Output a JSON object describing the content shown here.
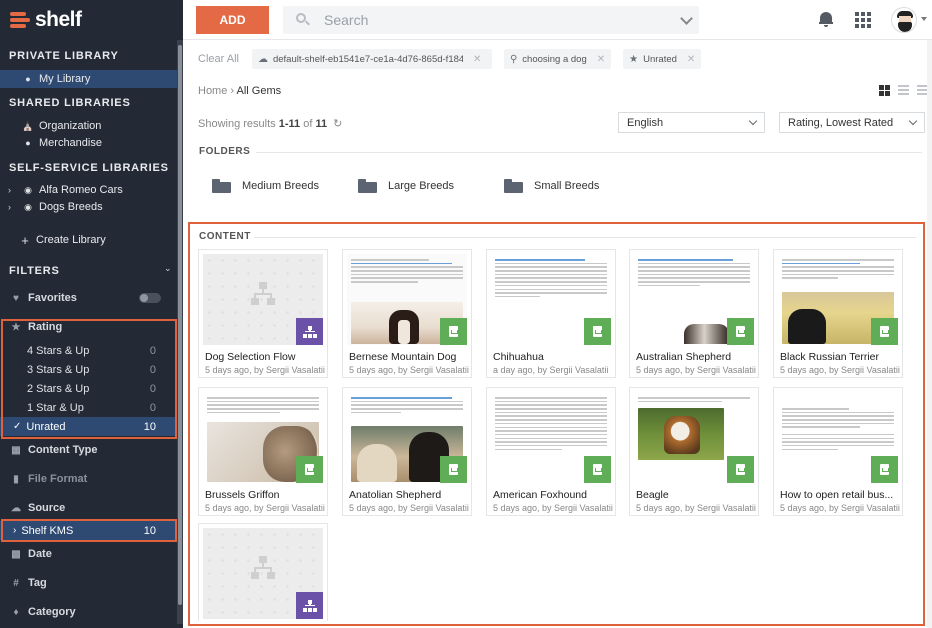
{
  "app": {
    "logo_text": "shelf"
  },
  "sidebar": {
    "private_library_heading": "PRIVATE LIBRARY",
    "my_library": "My Library",
    "shared_libraries_heading": "SHARED LIBRARIES",
    "shared": [
      "Organization",
      "Merchandise"
    ],
    "self_service_heading": "SELF-SERVICE LIBRARIES",
    "self_service": [
      "Alfa Romeo Cars",
      "Dogs Breeds"
    ],
    "create_library": "Create Library",
    "filters_heading": "FILTERS",
    "favorites": "Favorites",
    "rating": "Rating",
    "rating_options": [
      {
        "label": "4 Stars & Up",
        "count": "0"
      },
      {
        "label": "3 Stars & Up",
        "count": "0"
      },
      {
        "label": "2 Stars & Up",
        "count": "0"
      },
      {
        "label": "1 Star & Up",
        "count": "0"
      },
      {
        "label": "Unrated",
        "count": "10"
      }
    ],
    "content_type": "Content Type",
    "file_format": "File Format",
    "source": "Source",
    "source_item": {
      "label": "Shelf KMS",
      "count": "10"
    },
    "date": "Date",
    "tag": "Tag",
    "category": "Category"
  },
  "topbar": {
    "add_label": "ADD",
    "search_placeholder": "Search"
  },
  "chips": {
    "clear_all": "Clear All",
    "items": [
      "default-shelf-eb1541e7-ce1a-4d76-865d-f184468b35...",
      "choosing a dog",
      "Unrated"
    ]
  },
  "breadcrumb": {
    "home": "Home",
    "separator": "›",
    "current": "All Gems"
  },
  "results": {
    "prefix": "Showing results ",
    "range": "1-11",
    "of": " of ",
    "total": "11"
  },
  "language_select": "English",
  "sort_select": "Rating, Lowest Rated",
  "folders": {
    "heading": "FOLDERS",
    "items": [
      "Medium Breeds",
      "Large Breeds",
      "Small Breeds"
    ]
  },
  "content": {
    "heading": "CONTENT",
    "cards": [
      {
        "title": "Dog Selection Flow",
        "meta": "5 days ago, by Sergii Vasalatii",
        "kind": "flow"
      },
      {
        "title": "Bernese Mountain Dog",
        "meta": "5 days ago, by Sergii Vasalatii",
        "kind": "doc"
      },
      {
        "title": "Chihuahua",
        "meta": "a day ago, by Sergii Vasalatii",
        "kind": "doc"
      },
      {
        "title": "Australian Shepherd",
        "meta": "5 days ago, by Sergii Vasalatii",
        "kind": "doc"
      },
      {
        "title": "Black Russian Terrier",
        "meta": "5 days ago, by Sergii Vasalatii",
        "kind": "doc"
      },
      {
        "title": "Brussels Griffon",
        "meta": "5 days ago, by Sergii Vasalatii",
        "kind": "doc"
      },
      {
        "title": "Anatolian Shepherd",
        "meta": "5 days ago, by Sergii Vasalatii",
        "kind": "doc"
      },
      {
        "title": "American Foxhound",
        "meta": "5 days ago, by Sergii Vasalatii",
        "kind": "doc"
      },
      {
        "title": "Beagle",
        "meta": "5 days ago, by Sergii Vasalatii",
        "kind": "doc"
      },
      {
        "title": "How to open retail bus...",
        "meta": "5 days ago, by Sergii Vasalatii",
        "kind": "doc"
      },
      {
        "title": "",
        "meta": "",
        "kind": "flow"
      }
    ]
  },
  "colors": {
    "accent": "#e36a44",
    "sidebar_bg": "#232a35",
    "selected": "#2f4a72",
    "badge_purple": "#6b52a8",
    "badge_green": "#5fae57"
  }
}
